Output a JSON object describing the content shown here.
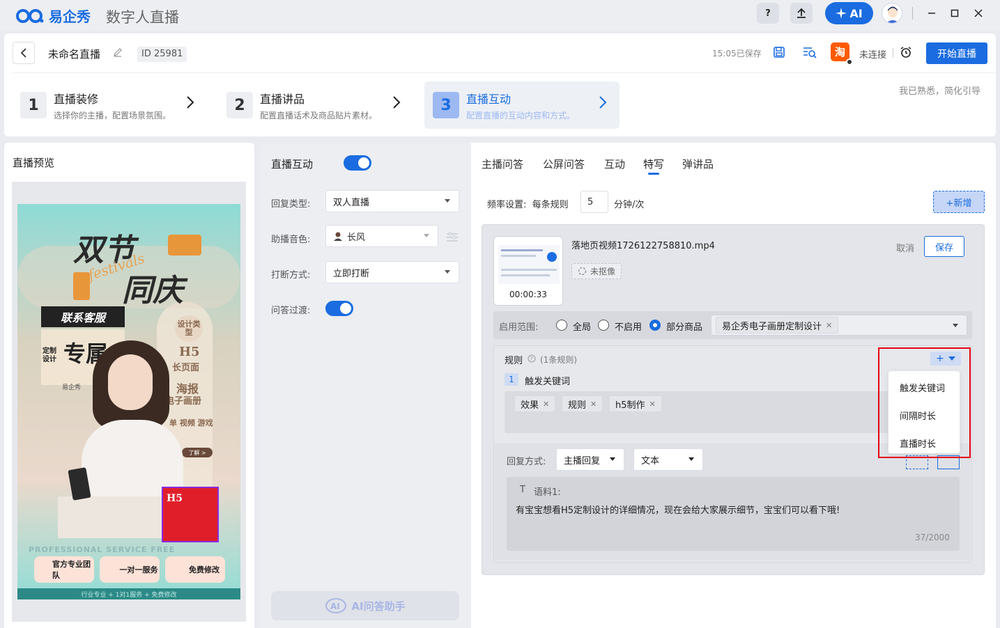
{
  "titlebar": {
    "logo_text": "易企秀",
    "app_title": "数字人直播",
    "help_label": "?",
    "ai_label": "AI"
  },
  "header": {
    "live_name": "未命名直播",
    "id_label": "ID",
    "id_value": "25981",
    "saved_text": "15:05已保存",
    "taobao_label": "淘",
    "not_connected": "未连接",
    "start_button": "开始直播",
    "skip_guide": "我已熟悉，简化引导"
  },
  "steps": [
    {
      "num": "1",
      "title": "直播装修",
      "desc": "选择你的主播，配置场景氛围。"
    },
    {
      "num": "2",
      "title": "直播讲品",
      "desc": "配置直播话术及商品贴片素材。"
    },
    {
      "num": "3",
      "title": "直播互动",
      "desc": "配置直播的互动内容和方式。"
    }
  ],
  "preview": {
    "title": "直播预览",
    "poster": {
      "line1": "双节",
      "line2": "同庆",
      "script": "festivals",
      "contact": "联系客服",
      "exclusive": "专属",
      "custom_design": "定制设计",
      "design_type": "设计类型",
      "h5": "H5",
      "h5_long": "长页面",
      "poster_label": "海报",
      "ebook": "电子画册",
      "more": "单 视频 游戏",
      "learn_more": "了解 >",
      "slogan": "PROFESSIONAL  SERVICE  FREE",
      "badge1": "官方专业团队",
      "badge2": "一对一服务",
      "badge3": "免费修改",
      "footer": "行业专业 + 1对1服务 + 免费修改",
      "brand": "易企秀"
    }
  },
  "settings": {
    "title": "直播互动",
    "reply_type_label": "回复类型:",
    "reply_type_value": "双人直播",
    "voice_label": "助播音色:",
    "voice_value": "长风",
    "interrupt_label": "打断方式:",
    "interrupt_value": "立即打断",
    "qa_transition_label": "问答过渡:",
    "ai_assistant": "AI问答助手"
  },
  "tabs": [
    "主播问答",
    "公屏问答",
    "互动",
    "特写",
    "弹讲品"
  ],
  "active_tab": "特写",
  "closeup": {
    "freq_label": "频率设置:",
    "freq_prefix": "每条规则",
    "freq_value": "5",
    "freq_unit": "分钟/次",
    "new_button": "+新增",
    "video_name": "落地页视频1726122758810.mp4",
    "video_duration": "00:00:33",
    "not_matted": "未抠像",
    "cancel": "取消",
    "save": "保存",
    "scope_label": "启用范围:",
    "scope_options": [
      "全局",
      "不启用",
      "部分商品"
    ],
    "scope_selected": "部分商品",
    "scope_product": "易企秀电子画册定制设计",
    "rules_title": "规则",
    "rules_count": "(1条规则)",
    "rule_num": "1",
    "rule_name": "触发关键词",
    "keywords": [
      "效果",
      "规则",
      "h5制作"
    ],
    "reply_mode_label": "回复方式:",
    "reply_mode_value": "主播回复",
    "reply_format_value": "文本",
    "corpus_label": "语料1:",
    "corpus_text": "有宝宝想看H5定制设计的详细情况，现在会给大家展示细节，宝宝们可以看下哦!",
    "char_count": "37/2000",
    "add_rule_symbol": "+",
    "dropdown_items": [
      "触发关键词",
      "间隔时长",
      "直播时长"
    ]
  },
  "colors": {
    "accent": "#1a6ce0",
    "highlight_border": "#e60012",
    "taobao": "#ff5a00"
  }
}
